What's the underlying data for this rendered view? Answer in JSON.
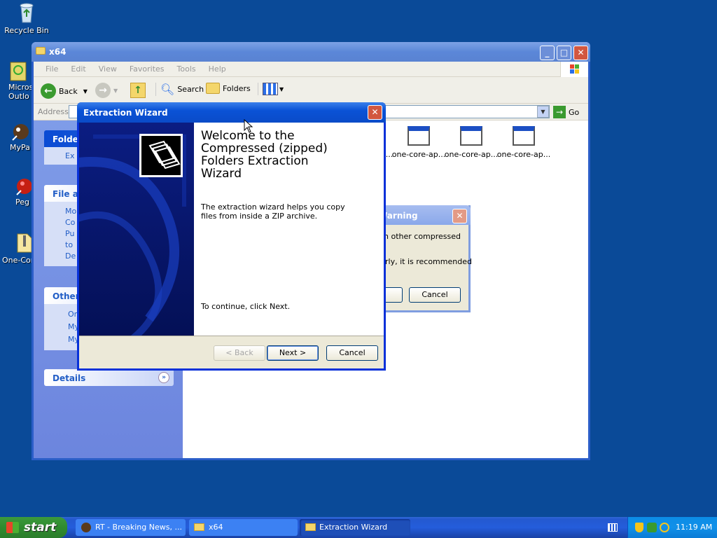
{
  "desktop": {
    "icons": [
      {
        "label": "Recycle Bin",
        "icon": "recycle-bin-icon"
      },
      {
        "label": "Micros",
        "label2": "Outlo",
        "icon": "outlook-icon"
      },
      {
        "label": "MyPa",
        "icon": "mypal-icon"
      },
      {
        "label": "Peg",
        "icon": "peg-icon"
      },
      {
        "label": "One-Cor",
        "icon": "zip-folder-icon"
      }
    ]
  },
  "explorer": {
    "title": "x64",
    "menu": [
      "File",
      "Edit",
      "View",
      "Favorites",
      "Tools",
      "Help"
    ],
    "toolbar": {
      "back": "Back",
      "search": "Search",
      "folders": "Folders"
    },
    "address_label": "Address",
    "go_label": "Go",
    "left_panels": {
      "folder": {
        "title": "Folder",
        "items": [
          "Ex"
        ]
      },
      "file": {
        "title": "File an",
        "items": [
          "Mo",
          "Co",
          "Pu",
          "to",
          "De"
        ]
      },
      "other": {
        "title": "Other",
        "items": [
          "On",
          "My",
          "My"
        ]
      },
      "details": {
        "title": "Details"
      }
    },
    "files": [
      "...",
      "one-core-ap...",
      "one-core-ap...",
      "one-core-ap..."
    ]
  },
  "warning": {
    "title": "Warning",
    "line1": "n other compressed",
    "line2": "rly, it is recommended",
    "cancel": "Cancel"
  },
  "wizard": {
    "title": "Extraction Wizard",
    "heading": "Welcome to the Compressed (zipped) Folders Extraction Wizard",
    "body": "The extraction wizard helps you copy files from inside a ZIP archive.",
    "continue": "To continue, click Next.",
    "back": "< Back",
    "next": "Next >",
    "cancel": "Cancel"
  },
  "taskbar": {
    "start": "start",
    "tasks": [
      {
        "label": "RT - Breaking News, ..."
      },
      {
        "label": "x64"
      },
      {
        "label": "Extraction Wizard"
      }
    ],
    "clock": "11:19 AM"
  }
}
